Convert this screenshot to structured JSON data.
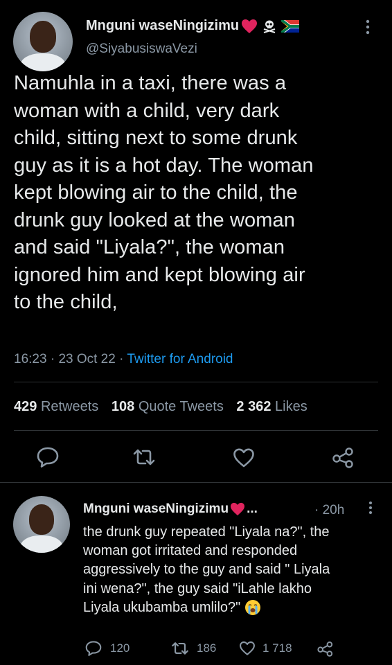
{
  "colors": {
    "background": "#000000",
    "text": "#e7e9ea",
    "muted": "#8b98a5",
    "link": "#1d9bf0",
    "heart": "#e0245e",
    "divider": "#2f3336"
  },
  "main_tweet": {
    "author_name": "Mnguni waseNingizimu",
    "author_emojis": [
      "red-heart",
      "skull-and-crossbones",
      "south-africa-flag"
    ],
    "handle": "@SiyabusiswaVezi",
    "text_lines": [
      "Namuhla in a taxi, there was a",
      "woman with a child, very dark",
      "child, sitting next to some drunk",
      "guy as it is a hot day. The woman",
      "kept blowing air to the child, the",
      "drunk guy looked at the woman",
      "and said \"Liyala?\", the woman",
      "ignored him and kept blowing air",
      "to the child,"
    ],
    "time": "16:23",
    "date": "23 Oct 22",
    "separator": "·",
    "source": "Twitter for Android",
    "stats": {
      "retweets": "429",
      "retweets_label": "Retweets",
      "quote_tweets": "108",
      "quote_tweets_label": "Quote Tweets",
      "likes": "2 362",
      "likes_label": "Likes"
    }
  },
  "reply": {
    "author_name": "Mnguni waseNingizimu",
    "author_emoji": "red-heart",
    "ellipsis": "...",
    "time": "· 20h",
    "text_lines": [
      "the drunk guy repeated \"Liyala na?\", the",
      "woman got irritated and responded",
      "aggressively to the guy and said \" Liyala",
      "ini wena?\", the guy said \"iLahle lakho",
      "Liyala ukubamba umlilo?\""
    ],
    "trailing_emoji": "loudly-crying-face",
    "counts": {
      "replies": "120",
      "retweets": "186",
      "likes": "1 718"
    }
  }
}
